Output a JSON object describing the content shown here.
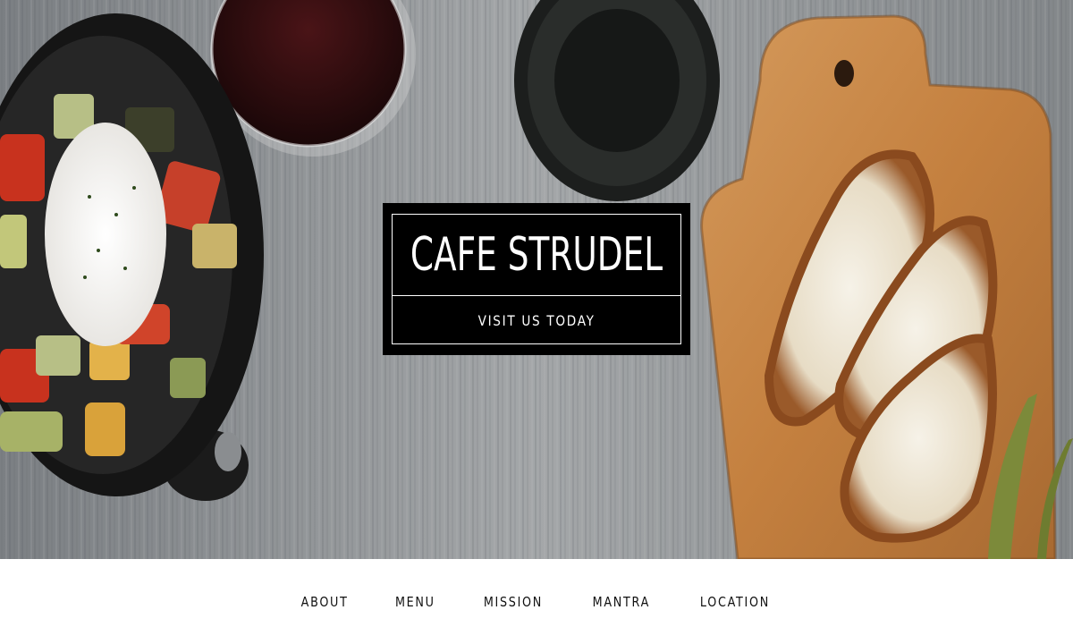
{
  "hero": {
    "brand_title": "CAFE STRUDEL",
    "cta_label": "VISIT US TODAY"
  },
  "nav": {
    "items": [
      {
        "label": "ABOUT"
      },
      {
        "label": "MENU"
      },
      {
        "label": "MISSION"
      },
      {
        "label": "MANTRA"
      },
      {
        "label": "LOCATION"
      }
    ]
  },
  "colors": {
    "title_box_bg": "#000000",
    "title_text": "#ffffff",
    "nav_text": "#111111",
    "nav_bg": "#ffffff",
    "wood_table": "#8f9396",
    "cutting_board": "#c98a4a"
  },
  "icons": [
    "skillet-image",
    "wine-glass-image",
    "wine-bottle-image",
    "cutting-board-image",
    "bread-image"
  ]
}
